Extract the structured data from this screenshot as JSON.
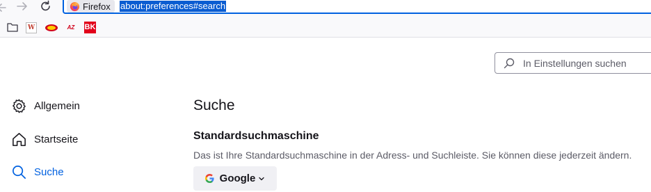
{
  "browser": {
    "identity_label": "Firefox",
    "url": "about:preferences#search"
  },
  "bookmarks": {
    "items": [
      {
        "icon": "folder-icon"
      },
      {
        "icon": "w-site-icon",
        "glyph": "W"
      },
      {
        "icon": "badge-site-icon"
      },
      {
        "icon": "az-site-icon",
        "glyph": "AZ"
      },
      {
        "icon": "bk-site-icon",
        "glyph": "BK"
      }
    ]
  },
  "search": {
    "placeholder": "In Einstellungen suchen"
  },
  "sidebar": {
    "items": [
      {
        "label": "Allgemein",
        "icon": "gear-icon",
        "selected": false
      },
      {
        "label": "Startseite",
        "icon": "home-icon",
        "selected": false
      },
      {
        "label": "Suche",
        "icon": "search-icon",
        "selected": true
      }
    ]
  },
  "main": {
    "title": "Suche",
    "default_engine": {
      "heading": "Standardsuchmaschine",
      "description": "Das ist Ihre Standardsuchmaschine in der Adress- und Suchleiste. Sie können diese jederzeit ändern.",
      "selected": "Google"
    }
  },
  "colors": {
    "accent": "#0061e0",
    "selection": "#0a5cd1",
    "text": "#15141a",
    "secondary_text": "#5b5b66",
    "button_bg": "#f0f0f4"
  }
}
